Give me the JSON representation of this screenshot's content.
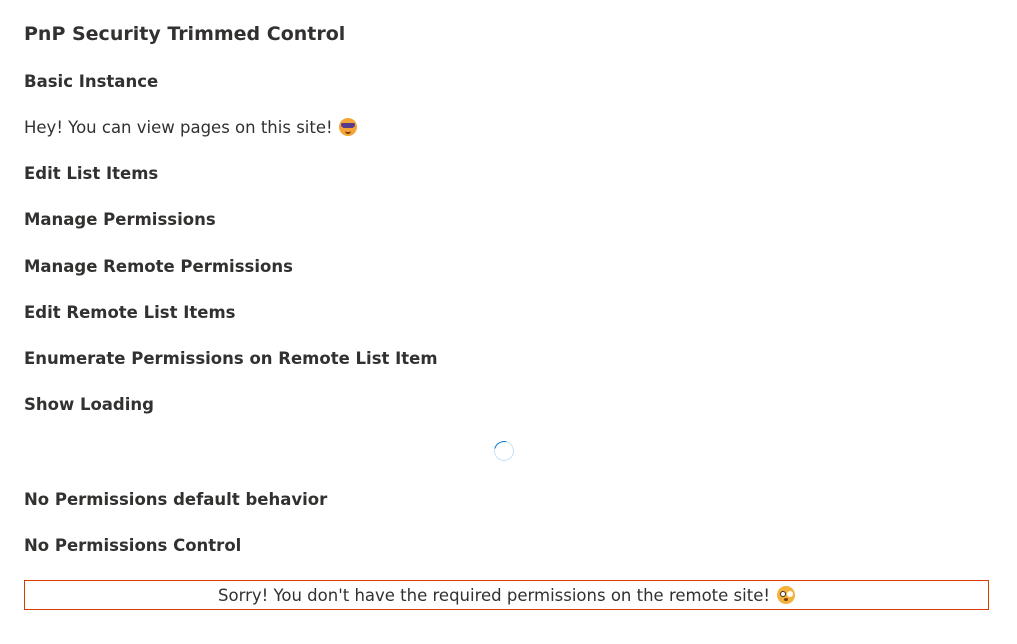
{
  "page": {
    "title": "PnP Security Trimmed Control"
  },
  "sections": {
    "basic_instance": "Basic Instance",
    "basic_message": "Hey! You can view pages on this site!",
    "edit_list_items": "Edit List Items",
    "manage_permissions": "Manage Permissions",
    "manage_remote_permissions": "Manage Remote Permissions",
    "edit_remote_list_items": "Edit Remote List Items",
    "enumerate_permissions": "Enumerate Permissions on Remote List Item",
    "show_loading": "Show Loading",
    "no_permissions_default": "No Permissions default behavior",
    "no_permissions_control": "No Permissions Control"
  },
  "no_permissions_message": "Sorry! You don't have the required permissions on the remote site!",
  "icons": {
    "basic_message_emoji": "smiling-face-with-sunglasses",
    "no_permissions_emoji": "flushed-face",
    "loading": "spinner"
  },
  "colors": {
    "text": "#323130",
    "error_border": "#d83b01",
    "spinner_accent": "#0078d4"
  }
}
